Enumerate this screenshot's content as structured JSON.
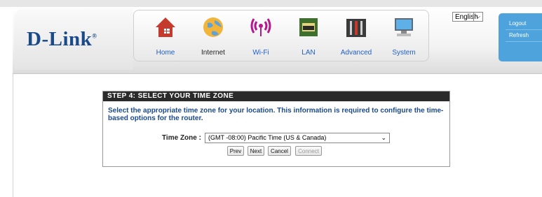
{
  "brand": {
    "logo_text": "D-Link"
  },
  "nav": {
    "items": [
      {
        "label": "Home",
        "icon": "home-icon"
      },
      {
        "label": "Internet",
        "icon": "globe-icon"
      },
      {
        "label": "Wi-Fi",
        "icon": "wifi-icon"
      },
      {
        "label": "LAN",
        "icon": "lan-icon"
      },
      {
        "label": "Advanced",
        "icon": "tools-icon"
      },
      {
        "label": "System",
        "icon": "computer-icon"
      }
    ],
    "active": "Internet"
  },
  "language": {
    "selected": "English"
  },
  "side_menu": {
    "logout": "Logout",
    "refresh": "Refresh"
  },
  "wizard": {
    "title": "STEP 4: SELECT YOUR TIME ZONE",
    "description": "Select the appropriate time zone for your location. This information is required to configure the time-based options for the router.",
    "time_zone_label": "Time Zone :",
    "time_zone_value": "(GMT -08:00) Pacific Time (US & Canada)",
    "buttons": {
      "prev": "Prev",
      "next": "Next",
      "cancel": "Cancel",
      "connect": "Connect"
    }
  },
  "colors": {
    "brand_blue": "#1a4a8a",
    "link_blue": "#1f5fc8",
    "side_blue": "#4fa3dc",
    "panel_header": "#2a2a2a"
  }
}
